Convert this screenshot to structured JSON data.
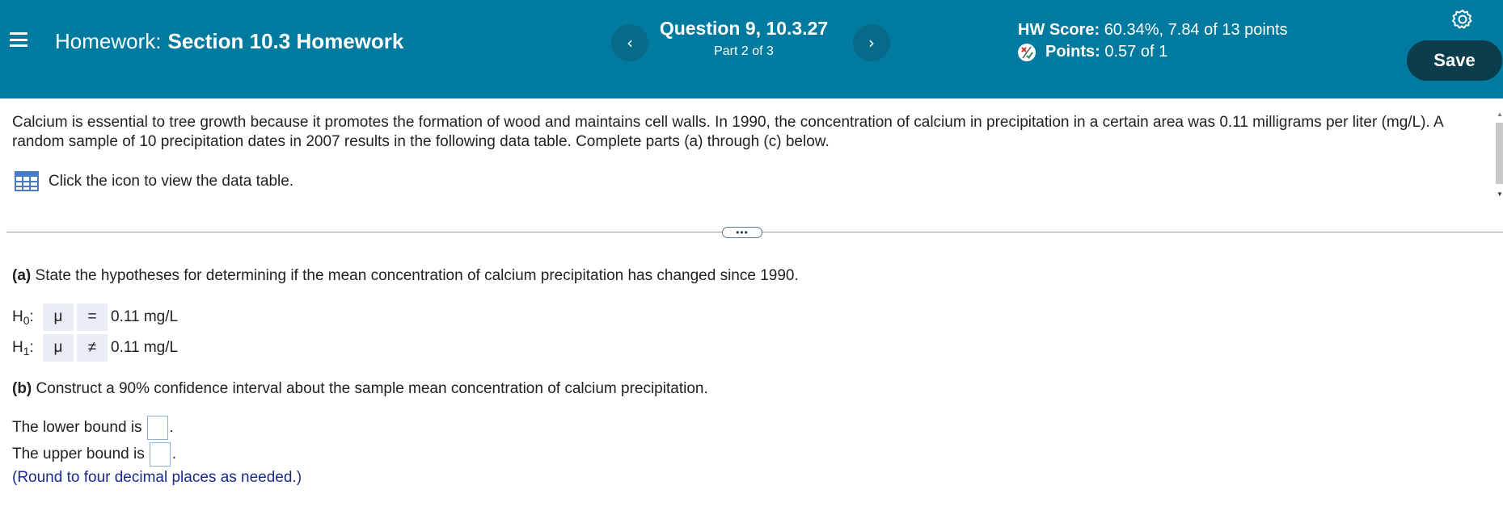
{
  "header": {
    "homework_prefix": "Homework:",
    "homework_name": "Section 10.3 Homework",
    "question_title": "Question 9, 10.3.27",
    "question_part": "Part 2 of 3",
    "hw_score_label": "HW Score:",
    "hw_score_value": "60.34%, 7.84 of 13 points",
    "points_label": "Points:",
    "points_value": "0.57 of 1",
    "save_label": "Save",
    "prev_glyph": "‹",
    "next_glyph": "›"
  },
  "problem": {
    "text": "Calcium is essential to tree growth because it promotes the formation of wood and maintains cell walls. In 1990, the concentration of calcium in precipitation in a certain area was 0.11 milligrams per liter (mg/L). A random sample of 10 precipitation dates in 2007 results in the following data table. Complete parts (a) through (c) below.",
    "data_link_text": "Click the icon to view the data table."
  },
  "part_a": {
    "label": "(a)",
    "text": "State the hypotheses for determining if the mean concentration of calcium precipitation has changed since 1990.",
    "h0": {
      "label": "H",
      "sub": "0",
      "param": "μ",
      "operator": "=",
      "value": "0.11 mg/L"
    },
    "h1": {
      "label": "H",
      "sub": "1",
      "param": "μ",
      "operator": "≠",
      "value": "0.11 mg/L"
    }
  },
  "part_b": {
    "label": "(b)",
    "text": "Construct a 90% confidence interval about the sample mean concentration of calcium precipitation.",
    "lower_text": "The lower bound is",
    "upper_text": "The upper bound is",
    "lower_value": "",
    "upper_value": "",
    "round_note": "(Round to four decimal places as needed.)"
  },
  "more_glyph": "•••",
  "colors": {
    "header_bg": "#007a9e",
    "save_bg": "#0c3d4d",
    "note_text": "#1a2a8a"
  }
}
